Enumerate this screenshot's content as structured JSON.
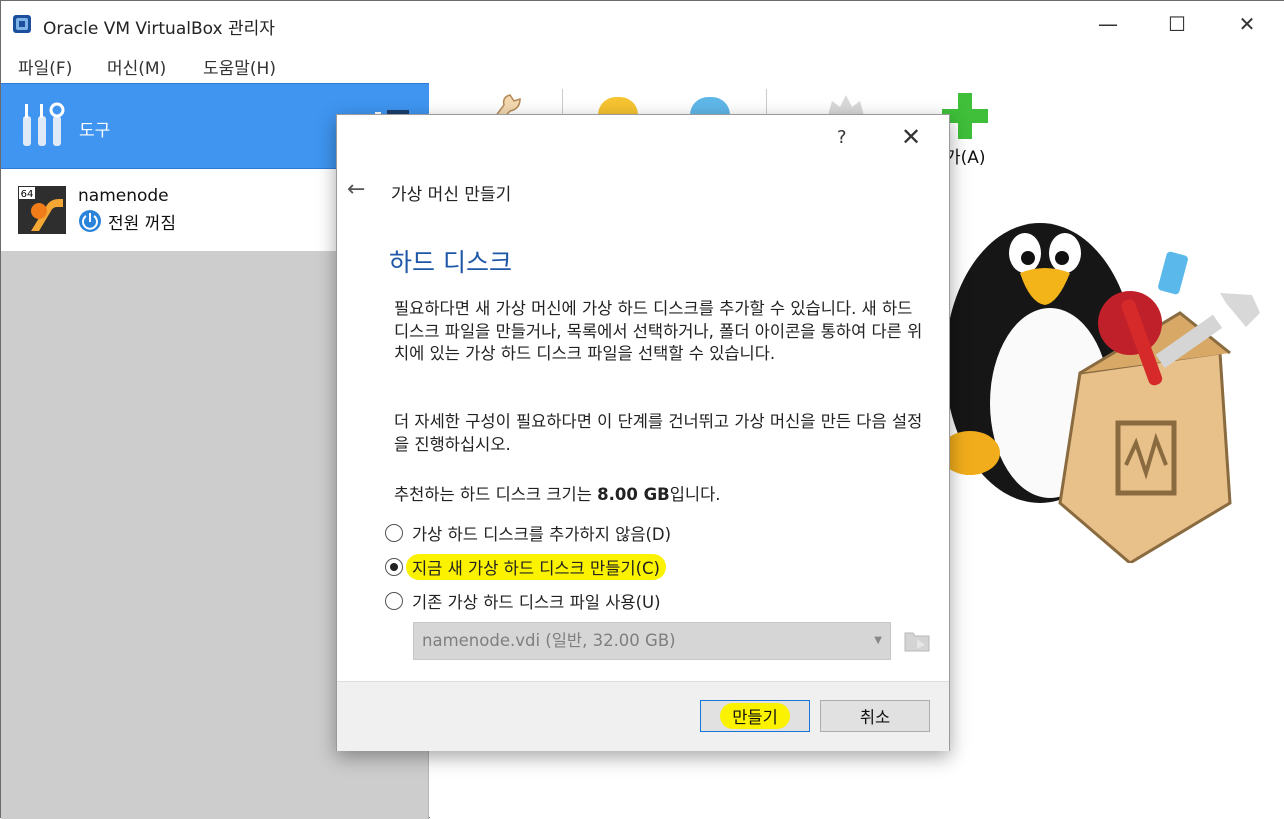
{
  "window": {
    "title": "Oracle VM VirtualBox 관리자",
    "controls": {
      "minimize": "—",
      "maximize": "☐",
      "close": "✕"
    }
  },
  "menu": [
    {
      "label": "파일(F)"
    },
    {
      "label": "머신(M)"
    },
    {
      "label": "도움말(H)"
    }
  ],
  "sidebar": {
    "tools_label": "도구",
    "vm": {
      "name": "namenode",
      "status": "전원 꺼짐",
      "badge": "64"
    }
  },
  "toolbar": {
    "add_label_partial": "가(A)"
  },
  "dialog": {
    "help": "?",
    "close": "✕",
    "back": "←",
    "heading": "가상 머신 만들기",
    "section_title": "하드 디스크",
    "para1": "필요하다면 새 가상 머신에 가상 하드 디스크를 추가할 수 있습니다. 새 하드 디스크 파일을 만들거나, 목록에서 선택하거나, 폴더 아이콘을 통하여 다른 위치에 있는 가상 하드 디스크 파일을 선택할 수 있습니다.",
    "para2": "더 자세한 구성이 필요하다면 이 단계를 건너뛰고 가상 머신을 만든 다음 설정을 진행하십시오.",
    "recommend_prefix": "추천하는 하드 디스크 크기는 ",
    "recommend_size": "8.00 GB",
    "recommend_suffix": "입니다.",
    "options": [
      {
        "label": "가상 하드 디스크를 추가하지 않음(D)",
        "checked": false
      },
      {
        "label": "지금 새 가상 하드 디스크 만들기(C)",
        "checked": true
      },
      {
        "label": "기존 가상 하드 디스크 파일 사용(U)",
        "checked": false
      }
    ],
    "combo_value": "namenode.vdi (일반, 32.00 GB)",
    "buttons": {
      "create": "만들기",
      "cancel": "취소"
    }
  },
  "colors": {
    "accent": "#3f95f0",
    "highlight": "#fbf200",
    "title_blue": "#1f57a6"
  }
}
